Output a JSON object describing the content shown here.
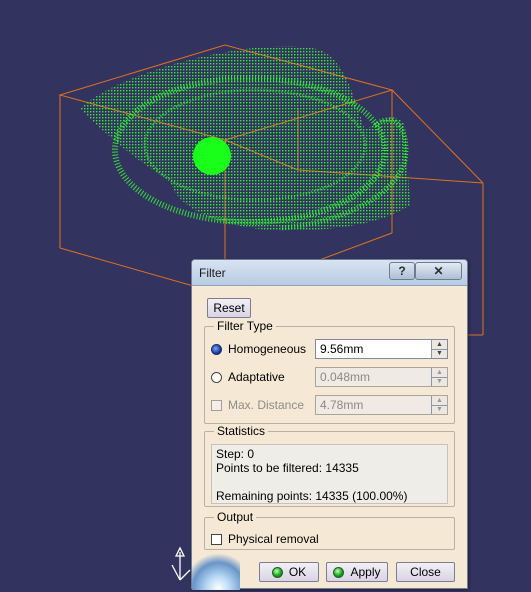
{
  "colors": {
    "background": "#33335f",
    "pointcloud": "#33ff33",
    "bounding_box": "#e07020",
    "dialog_bg": "#f5e9d6"
  },
  "viewport": {
    "icons": [
      "pointcloud-icon",
      "bounding-box-icon",
      "axis-compass-icon"
    ]
  },
  "dialog": {
    "title": "Filter",
    "help_label": "?",
    "close_glyph": "✕",
    "reset_label": "Reset",
    "filter_type": {
      "legend": "Filter Type",
      "homogeneous_label": "Homogeneous",
      "homogeneous_value": "9.56mm",
      "homogeneous_selected": true,
      "adaptative_label": "Adaptative",
      "adaptative_value": "0.048mm",
      "max_distance_label": "Max. Distance",
      "max_distance_value": "4.78mm",
      "max_distance_checked": false
    },
    "statistics": {
      "legend": "Statistics",
      "step": "Step: 0",
      "to_filter": "Points to be filtered: 14335",
      "blank": "",
      "remaining": "Remaining points: 14335 (100.00%)"
    },
    "output": {
      "legend": "Output",
      "physical_removal_label": "Physical removal",
      "physical_removal_checked": false
    },
    "buttons": {
      "ok": "OK",
      "apply": "Apply",
      "close": "Close"
    }
  }
}
